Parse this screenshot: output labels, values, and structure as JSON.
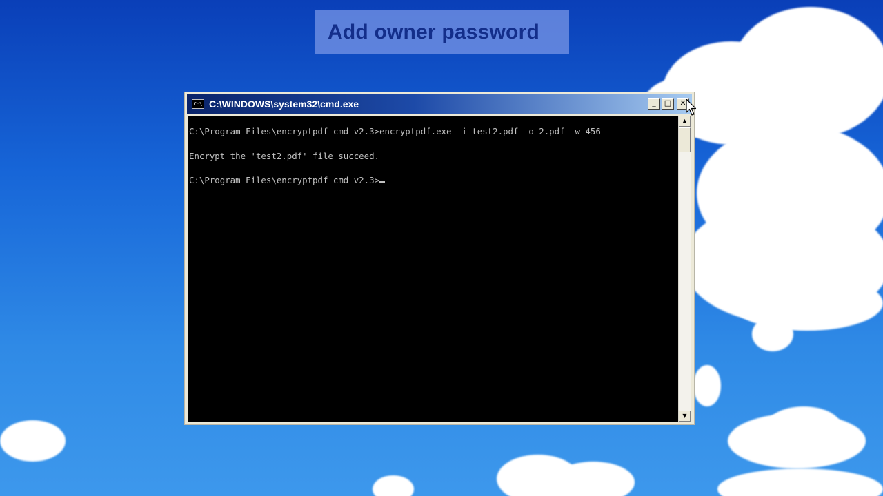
{
  "caption": {
    "text": "Add owner password"
  },
  "window": {
    "title": "C:\\WINDOWS\\system32\\cmd.exe",
    "icon_label": "C:\\",
    "buttons": {
      "minimize": "_",
      "maximize": "□",
      "close": "✕"
    }
  },
  "console": {
    "lines": [
      "C:\\Program Files\\encryptpdf_cmd_v2.3>encryptpdf.exe -i test2.pdf -o 2.pdf -w 456",
      "Encrypt the 'test2.pdf' file succeed.",
      "C:\\Program Files\\encryptpdf_cmd_v2.3>"
    ]
  },
  "scrollbar": {
    "up_arrow": "▲",
    "down_arrow": "▼"
  },
  "colors": {
    "console_bg": "#000000",
    "console_text": "#c0c0c0",
    "titlebar_start": "#0a246a",
    "titlebar_end": "#a6caf0",
    "caption_text": "#132e8a"
  }
}
